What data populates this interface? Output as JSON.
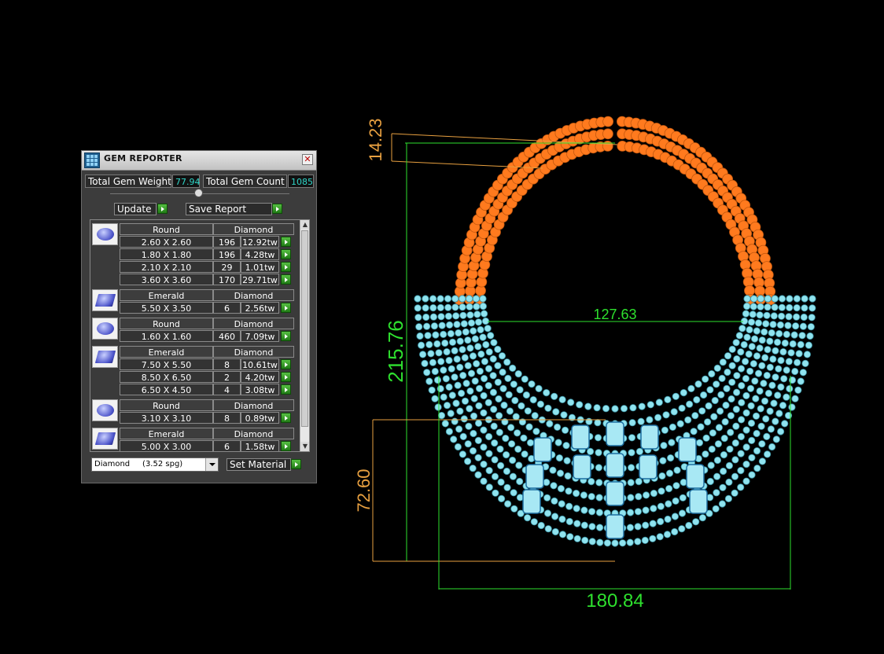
{
  "panel": {
    "title": "GEM REPORTER",
    "close_glyph": "✕",
    "total_weight_label": "Total Gem Weight",
    "total_weight_value": "77.94",
    "total_count_label": "Total Gem Count",
    "total_count_value": "1085",
    "update_label": "Update",
    "save_report_label": "Save Report",
    "material_value": "Diamond     (3.52 spg)",
    "set_material_label": "Set Material"
  },
  "groups": [
    {
      "shape": "Round",
      "material": "Diamond",
      "icon": "round-gem-icon",
      "rows": [
        {
          "size": "2.60 X 2.60",
          "count": "196",
          "weight": "12.92tw"
        },
        {
          "size": "1.80 X 1.80",
          "count": "196",
          "weight": "4.28tw"
        },
        {
          "size": "2.10 X 2.10",
          "count": "29",
          "weight": "1.01tw"
        },
        {
          "size": "3.60 X 3.60",
          "count": "170",
          "weight": "29.71tw"
        }
      ]
    },
    {
      "shape": "Emerald",
      "material": "Diamond",
      "icon": "emerald-gem-icon",
      "rows": [
        {
          "size": "5.50 X 3.50",
          "count": "6",
          "weight": "2.56tw"
        }
      ]
    },
    {
      "shape": "Round",
      "material": "Diamond",
      "icon": "round-gem-icon",
      "rows": [
        {
          "size": "1.60 X 1.60",
          "count": "460",
          "weight": "7.09tw"
        }
      ]
    },
    {
      "shape": "Emerald",
      "material": "Diamond",
      "icon": "emerald-gem-icon",
      "rows": [
        {
          "size": "7.50 X 5.50",
          "count": "8",
          "weight": "10.61tw"
        },
        {
          "size": "8.50 X 6.50",
          "count": "2",
          "weight": "4.20tw"
        },
        {
          "size": "6.50 X 4.50",
          "count": "4",
          "weight": "3.08tw"
        }
      ]
    },
    {
      "shape": "Round",
      "material": "Diamond",
      "icon": "round-gem-icon",
      "rows": [
        {
          "size": "3.10 X 3.10",
          "count": "8",
          "weight": "0.89tw"
        }
      ]
    },
    {
      "shape": "Emerald",
      "material": "Diamond",
      "icon": "emerald-gem-icon",
      "rows": [
        {
          "size": "5.00 X 3.00",
          "count": "6",
          "weight": "1.58tw"
        }
      ]
    }
  ],
  "dimensions": {
    "top_gap": "14.23",
    "total_height": "215.76",
    "inner_width": "127.63",
    "lower_height": "72.60",
    "total_width": "180.84"
  },
  "colors": {
    "orange_stones": "#ff7a1e",
    "blue_stones": "#8fe3ef",
    "dim_green": "#2ee02e",
    "dim_orange": "#e8a040"
  }
}
